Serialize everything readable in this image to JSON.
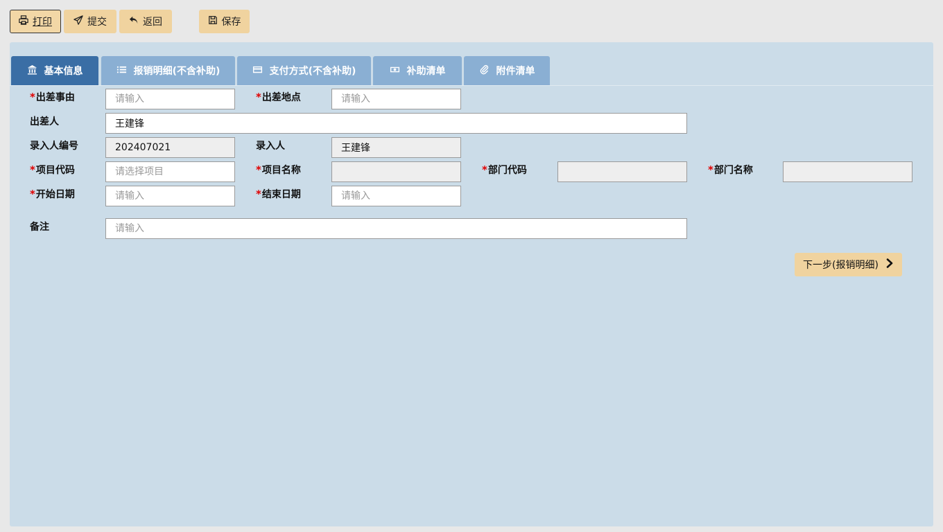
{
  "toolbar": {
    "print": {
      "label": "打印",
      "icon": "printer-icon"
    },
    "submit": {
      "label": "提交",
      "icon": "paper-plane-icon"
    },
    "back": {
      "label": "返回",
      "icon": "undo-arrow-icon"
    },
    "save": {
      "label": "保存",
      "icon": "floppy-disk-icon"
    }
  },
  "tabs": [
    {
      "label": "基本信息",
      "icon": "bank-icon",
      "active": true
    },
    {
      "label": "报销明细(不含补助)",
      "icon": "list-icon",
      "active": false
    },
    {
      "label": "支付方式(不含补助)",
      "icon": "credit-card-icon",
      "active": false
    },
    {
      "label": "补助清单",
      "icon": "money-icon",
      "active": false
    },
    {
      "label": "附件清单",
      "icon": "paperclip-icon",
      "active": false
    }
  ],
  "form": {
    "trip_reason": {
      "label": "出差事由",
      "required": true,
      "value": "",
      "placeholder": "请输入"
    },
    "trip_location": {
      "label": "出差地点",
      "required": true,
      "value": "",
      "placeholder": "请输入"
    },
    "traveler": {
      "label": "出差人",
      "required": false,
      "value": "王建锋",
      "placeholder": ""
    },
    "entry_id": {
      "label": "录入人编号",
      "required": false,
      "value": "202407021",
      "placeholder": ""
    },
    "entry_person": {
      "label": "录入人",
      "required": false,
      "value": "王建锋",
      "placeholder": ""
    },
    "project_code": {
      "label": "项目代码",
      "required": true,
      "value": "",
      "placeholder": "请选择项目"
    },
    "project_name": {
      "label": "项目名称",
      "required": true,
      "value": "",
      "placeholder": ""
    },
    "dept_code": {
      "label": "部门代码",
      "required": true,
      "value": "",
      "placeholder": ""
    },
    "dept_name": {
      "label": "部门名称",
      "required": true,
      "value": "",
      "placeholder": ""
    },
    "start_date": {
      "label": "开始日期",
      "required": true,
      "value": "",
      "placeholder": "请输入"
    },
    "end_date": {
      "label": "结束日期",
      "required": true,
      "value": "",
      "placeholder": "请输入"
    },
    "remarks": {
      "label": "备注",
      "required": false,
      "value": "",
      "placeholder": "请输入"
    }
  },
  "required_mark": "*",
  "next_button": {
    "label": "下一步(报销明细)",
    "icon": "chevron-right-icon"
  },
  "colors": {
    "button_bg": "#f0d39f",
    "panel_bg": "#cbdce8",
    "tab_active": "#3a6ea5",
    "tab_inactive": "#8aafd3",
    "required": "#e00000"
  }
}
